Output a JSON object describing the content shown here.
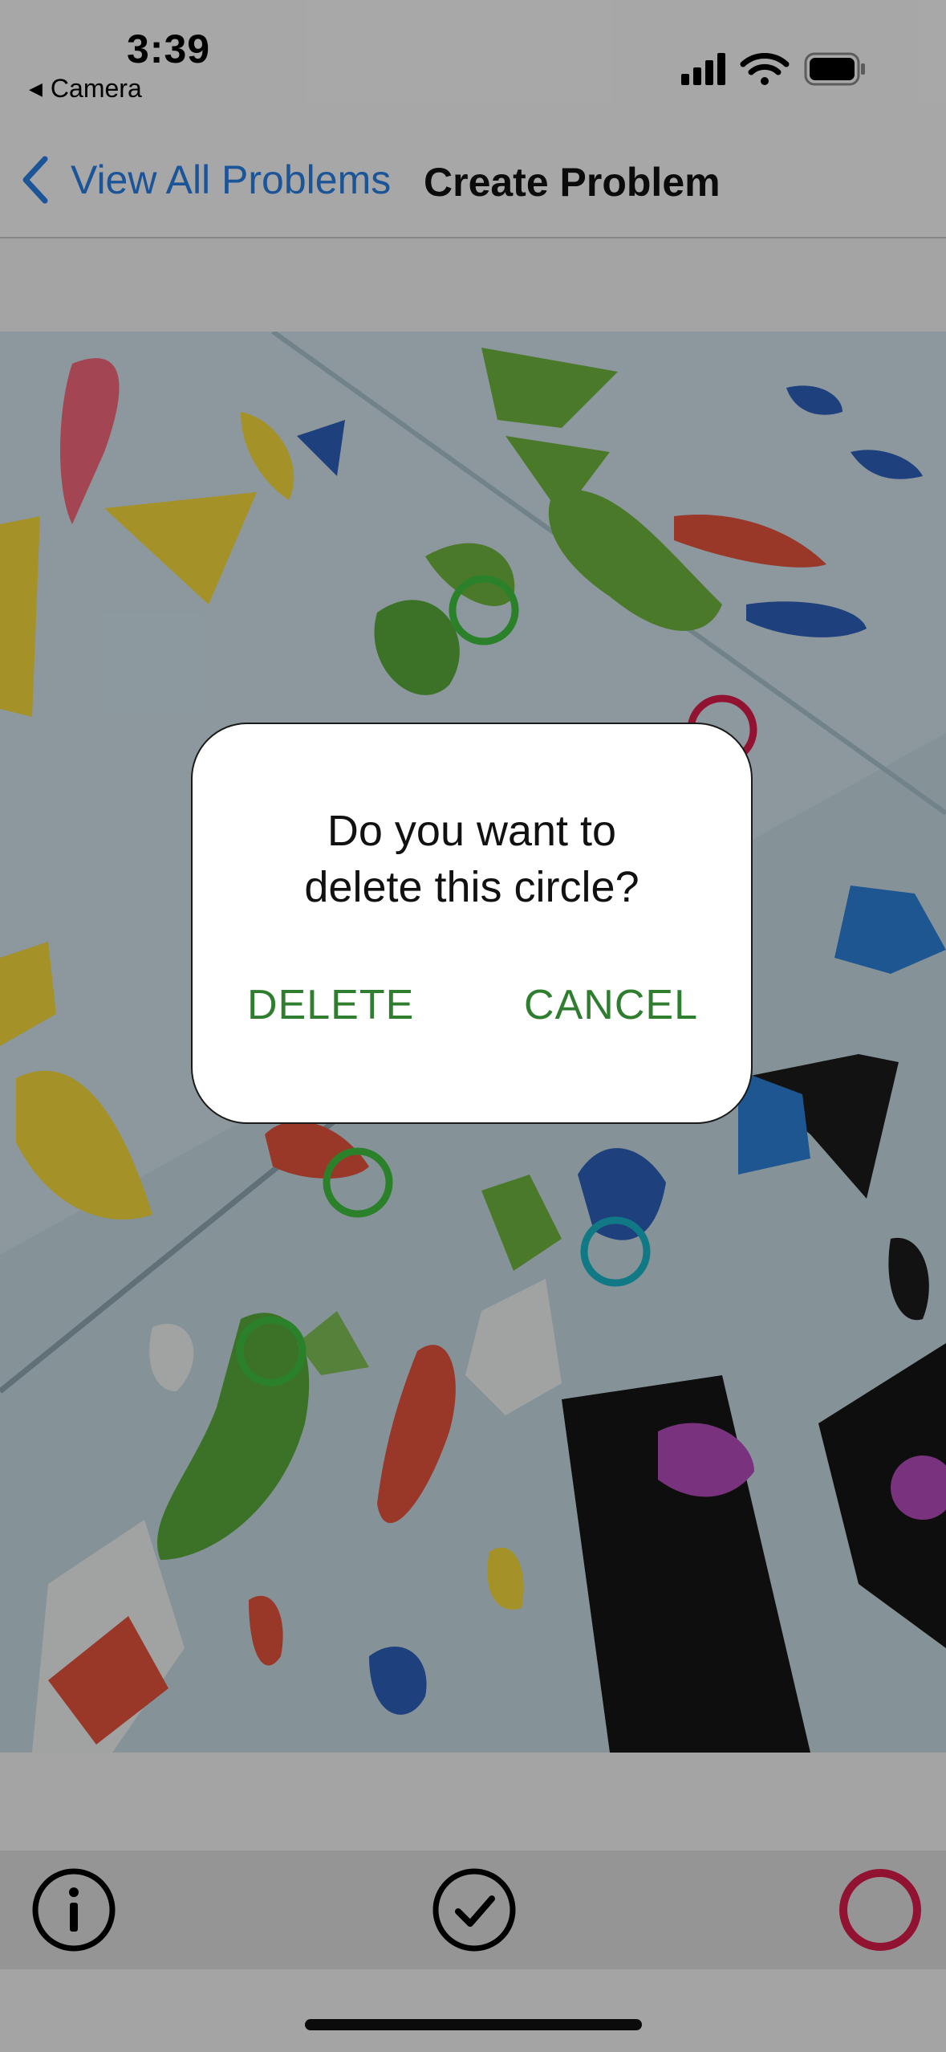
{
  "status_bar": {
    "time": "3:39",
    "back_app": "Camera",
    "icons": [
      "cellular-signal-icon",
      "wifi-icon",
      "battery-icon"
    ]
  },
  "nav": {
    "back_label": "View All Problems",
    "title": "Create Problem"
  },
  "holds": [
    {
      "color": "green"
    },
    {
      "color": "crimson"
    },
    {
      "color": "green"
    },
    {
      "color": "teal"
    },
    {
      "color": "green"
    }
  ],
  "dialog": {
    "message_line1": "Do you want to",
    "message_line2": "delete this circle?",
    "delete_label": "DELETE",
    "cancel_label": "CANCEL"
  },
  "toolbar": {
    "items": [
      "info-icon",
      "checkmark-circle-icon",
      "circle-tool-icon"
    ]
  },
  "colors": {
    "accent_blue": "#2a7de1",
    "dialog_button_green": "#2f7d2f",
    "circle_green": "#3fbf3f",
    "circle_crimson": "#d81b4a",
    "circle_teal": "#19b3c4"
  }
}
